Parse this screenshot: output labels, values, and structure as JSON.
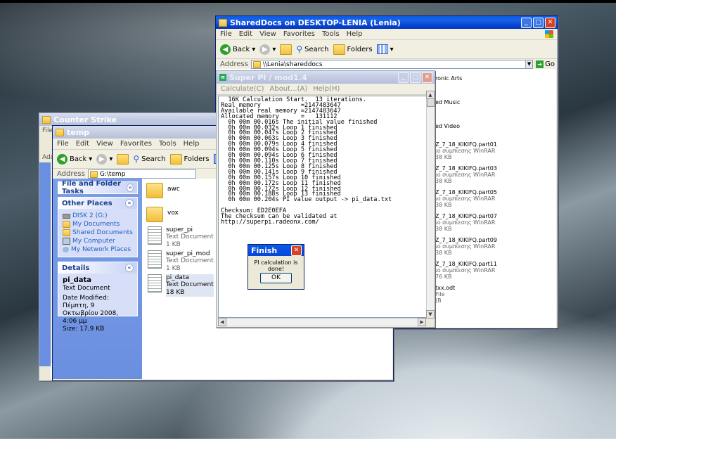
{
  "shareddocs": {
    "title": "SharedDocs on DESKTOP-LENIA (Lenia)",
    "menu": [
      "File",
      "Edit",
      "View",
      "Favorites",
      "Tools",
      "Help"
    ],
    "back": "Back",
    "search": "Search",
    "folders": "Folders",
    "address_label": "Address",
    "address": "\\\\Lenia\\shareddocs",
    "go": "Go",
    "items": [
      {
        "name": "ronic Arts",
        "meta1": "",
        "meta2": ""
      },
      {
        "name": "ed Music",
        "meta1": "",
        "meta2": ""
      },
      {
        "name": "ed Video",
        "meta1": "",
        "meta2": ""
      },
      {
        "name": "Z_7_18_KIKIFQ.part01",
        "meta1": "ιο συμπίεσης WinRAR",
        "meta2": "38 KB"
      },
      {
        "name": "Z_7_18_KIKIFQ.part03",
        "meta1": "ιο συμπίεσης WinRAR",
        "meta2": "38 KB"
      },
      {
        "name": "Z_7_18_KIKIFQ.part05",
        "meta1": "ιο συμπίεσης WinRAR",
        "meta2": "38 KB"
      },
      {
        "name": "Z_7_18_KIKIFQ.part07",
        "meta1": "ιο συμπίεσης WinRAR",
        "meta2": "38 KB"
      },
      {
        "name": "Z_7_18_KIKIFQ.part09",
        "meta1": "ιο συμπίεσης WinRAR",
        "meta2": "38 KB"
      },
      {
        "name": "Z_7_18_KIKIFQ.part11",
        "meta1": "ιο συμπίεσης WinRAR",
        "meta2": "76 KB"
      },
      {
        "name": "txx.odt",
        "meta1": "File",
        "meta2": "(B"
      }
    ]
  },
  "counterstrike": {
    "title": "Counter Strike",
    "menu_first": "File",
    "addr_label": "Add"
  },
  "temp": {
    "title": "temp",
    "menu": [
      "File",
      "Edit",
      "View",
      "Favorites",
      "Tools",
      "Help"
    ],
    "back": "Back",
    "search": "Search",
    "folders": "Folders",
    "address_label": "Address",
    "address": "G:\\temp",
    "tasks_title": "File and Folder Tasks",
    "places_title": "Other Places",
    "places": [
      "DISK 2 (G:)",
      "My Documents",
      "Shared Documents",
      "My Computer",
      "My Network Places"
    ],
    "details_title": "Details",
    "details": {
      "name": "pi_data",
      "type": "Text Document",
      "modified": "Date Modified: Πέμπτη, 9",
      "modified2": "Οκτωβρίου 2008, 4:06 μμ",
      "size": "Size: 17,9 KB"
    },
    "files": [
      {
        "name": "awc",
        "type": "",
        "size": ""
      },
      {
        "name": "vox",
        "type": "",
        "size": ""
      },
      {
        "name": "super_pi",
        "type": "Text Document",
        "size": "1 KB"
      },
      {
        "name": "super_pi_mod",
        "type": "Text Document",
        "size": "1 KB"
      },
      {
        "name": "pi_data",
        "type": "Text Document",
        "size": "18 KB"
      }
    ]
  },
  "superpi": {
    "title": "Super PI / mod1.4",
    "menu": [
      "Calculate(C)",
      "About...(A)",
      "Help(H)"
    ],
    "output": "  16K Calculation Start.  13 iterations.\nReal memory           =2147483647\nAvailable real memory =2147483647\nAllocated memory      =   131112\n  0h 00m 00.016s The initial value finished\n  0h 00m 00.032s Loop 1 finished\n  0h 00m 00.047s Loop 2 finished\n  0h 00m 00.063s Loop 3 finished\n  0h 00m 00.079s Loop 4 finished\n  0h 00m 00.094s Loop 5 finished\n  0h 00m 00.094s Loop 6 finished\n  0h 00m 00.110s Loop 7 finished\n  0h 00m 00.125s Loop 8 finished\n  0h 00m 00.141s Loop 9 finished\n  0h 00m 00.157s Loop 10 finished\n  0h 00m 00.172s Loop 11 finished\n  0h 00m 00.172s Loop 12 finished\n  0h 00m 00.188s Loop 13 finished\n  0h 00m 00.204s PI value output -> pi_data.txt\n\nChecksum: ED2E0EFA\nThe checksum can be validated at\nhttp://superpi.radeonx.com/"
  },
  "dialog": {
    "title": "Finish",
    "message": "PI calculation is done!",
    "ok": "OK"
  }
}
